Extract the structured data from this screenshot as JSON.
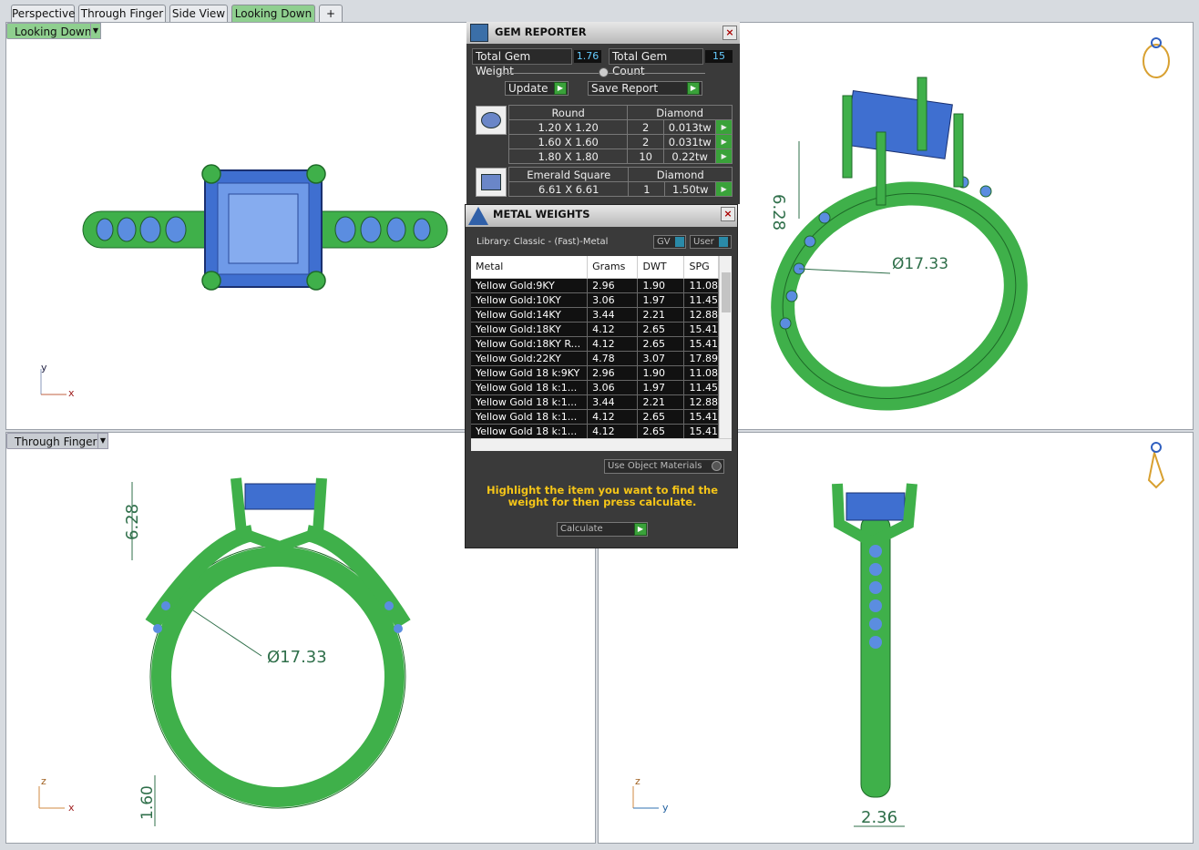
{
  "tabs": {
    "items": [
      {
        "label": "Perspective",
        "active": false
      },
      {
        "label": "Through Finger",
        "active": false
      },
      {
        "label": "Side View",
        "active": false
      },
      {
        "label": "Looking Down",
        "active": true
      }
    ],
    "add_tab_label": "+"
  },
  "viewports": {
    "top_left": {
      "label": "Looking Down",
      "axis_v": "y",
      "axis_h": "x"
    },
    "bottom_left": {
      "label": "Through Finger",
      "axis_v": "z",
      "axis_h": "x"
    },
    "bottom_right": {
      "axis_v": "z",
      "axis_h": "y"
    },
    "dims": {
      "height_right": "6.28",
      "diameter_right": "Ø17.33",
      "height_left": "6.28",
      "diameter_left": "Ø17.33",
      "thickness_left": "1.60",
      "width_side": "2.36"
    }
  },
  "gem_reporter": {
    "title": "GEM REPORTER",
    "close_label": "×",
    "total_weight_label": "Total Gem Weight",
    "total_weight_value": "1.76",
    "total_count_label": "Total Gem Count",
    "total_count_value": "15",
    "update_label": "Update",
    "save_report_label": "Save Report",
    "groups": [
      {
        "shape": "Round",
        "material": "Diamond",
        "rows": [
          {
            "size": "1.20 X 1.20",
            "count": "2",
            "weight": "0.013tw"
          },
          {
            "size": "1.60 X 1.60",
            "count": "2",
            "weight": "0.031tw"
          },
          {
            "size": "1.80 X 1.80",
            "count": "10",
            "weight": "0.22tw"
          }
        ]
      },
      {
        "shape": "Emerald Square",
        "material": "Diamond",
        "rows": [
          {
            "size": "6.61 X 6.61",
            "count": "1",
            "weight": "1.50tw"
          }
        ]
      }
    ]
  },
  "metal_weights": {
    "title": "METAL WEIGHTS",
    "close_label": "×",
    "library_label": "Library: Classic - (Fast)-Metal",
    "gv_label": "GV",
    "user_label": "User",
    "columns": [
      "Metal",
      "Grams",
      "DWT",
      "SPG"
    ],
    "rows": [
      {
        "metal": "Yellow Gold:9KY",
        "grams": "2.96",
        "dwt": "1.90",
        "spg": "11.08"
      },
      {
        "metal": "Yellow Gold:10KY",
        "grams": "3.06",
        "dwt": "1.97",
        "spg": "11.45"
      },
      {
        "metal": "Yellow Gold:14KY",
        "grams": "3.44",
        "dwt": "2.21",
        "spg": "12.88"
      },
      {
        "metal": "Yellow Gold:18KY",
        "grams": "4.12",
        "dwt": "2.65",
        "spg": "15.41"
      },
      {
        "metal": "Yellow Gold:18KY R...",
        "grams": "4.12",
        "dwt": "2.65",
        "spg": "15.41"
      },
      {
        "metal": "Yellow Gold:22KY",
        "grams": "4.78",
        "dwt": "3.07",
        "spg": "17.89"
      },
      {
        "metal": "Yellow Gold 18 k:9KY",
        "grams": "2.96",
        "dwt": "1.90",
        "spg": "11.08"
      },
      {
        "metal": "Yellow Gold 18 k:1...",
        "grams": "3.06",
        "dwt": "1.97",
        "spg": "11.45"
      },
      {
        "metal": "Yellow Gold 18 k:1...",
        "grams": "3.44",
        "dwt": "2.21",
        "spg": "12.88"
      },
      {
        "metal": "Yellow Gold 18 k:1...",
        "grams": "4.12",
        "dwt": "2.65",
        "spg": "15.41"
      },
      {
        "metal": "Yellow Gold 18 k:1...",
        "grams": "4.12",
        "dwt": "2.65",
        "spg": "15.41"
      }
    ],
    "use_object_materials_label": "Use Object Materials",
    "message": "Highlight the item you want to find the weight for then press calculate.",
    "calculate_label": "Calculate"
  },
  "colors": {
    "metal_green": "#3fb04a",
    "gem_blue": "#5b8de0",
    "dimension_green": "#2f6f4a"
  }
}
